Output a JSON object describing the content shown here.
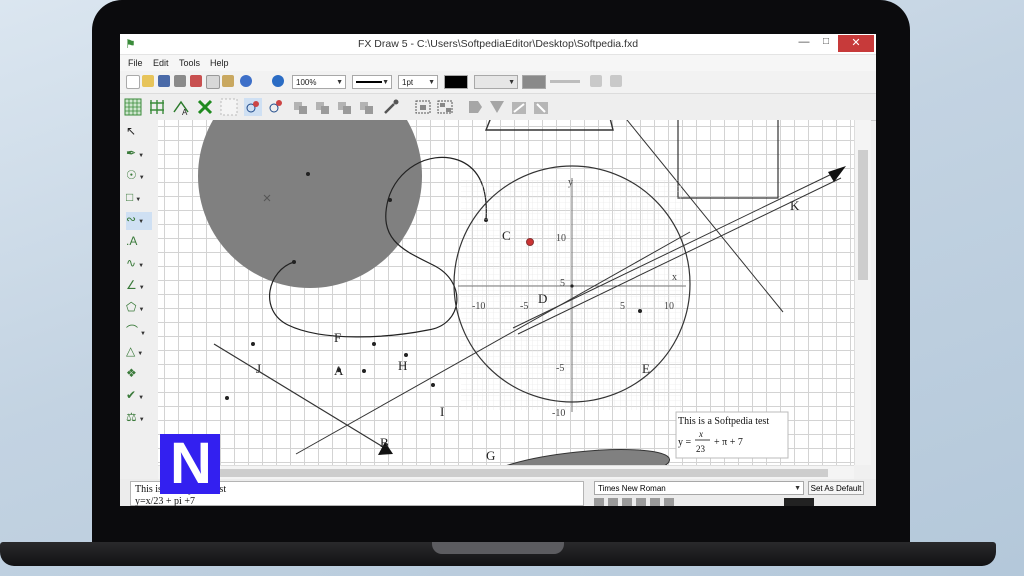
{
  "window": {
    "title": "FX Draw 5 - C:\\Users\\SoftpediaEditor\\Desktop\\Softpedia.fxd",
    "min_label": "—",
    "max_label": "□",
    "close_label": "✕"
  },
  "menu": [
    "File",
    "Edit",
    "Tools",
    "Help"
  ],
  "toolbar": {
    "zoom": "100%",
    "line_width": "1pt",
    "colors": {
      "line": "#000000",
      "fill": "#808080"
    }
  },
  "canvas": {
    "point_labels": [
      "K",
      "C",
      "D",
      "F",
      "J",
      "A",
      "H",
      "I",
      "E",
      "B",
      "G"
    ],
    "axis_x_label": "x",
    "axis_y_label": "y",
    "x_ticks": [
      "-10",
      "-5",
      "5",
      "10"
    ],
    "y_ticks": [
      "10",
      "5",
      "-5",
      "-10"
    ],
    "text_box_line1": "This is a Softpedia test",
    "formula_lhs": "y =",
    "formula_num": "x",
    "formula_den": "23",
    "formula_rest": "+ π + 7",
    "shape_fill": "#808080"
  },
  "bottom": {
    "editor_line1": "This is a Softpedia test",
    "editor_line2": "y=x/23 + pi +7",
    "font_name": "Times New Roman",
    "set_default_label": "Set As Default"
  },
  "overlay_logo": "N"
}
